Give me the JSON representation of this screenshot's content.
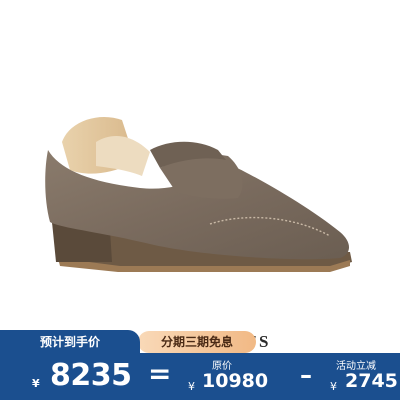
{
  "brand": {
    "text": "N'S"
  },
  "badge": {
    "installment": "分期三期免息"
  },
  "price": {
    "final_label": "预计到手价",
    "currency": "¥",
    "final_value": "8235",
    "equals": "=",
    "original_label": "原价",
    "original_value": "10980",
    "minus": "–",
    "discount_label": "活动立减",
    "discount_value": "2745"
  },
  "colors": {
    "price_bar": "#1b4f8f",
    "badge_start": "#f9d9b8",
    "badge_end": "#f1b985"
  }
}
